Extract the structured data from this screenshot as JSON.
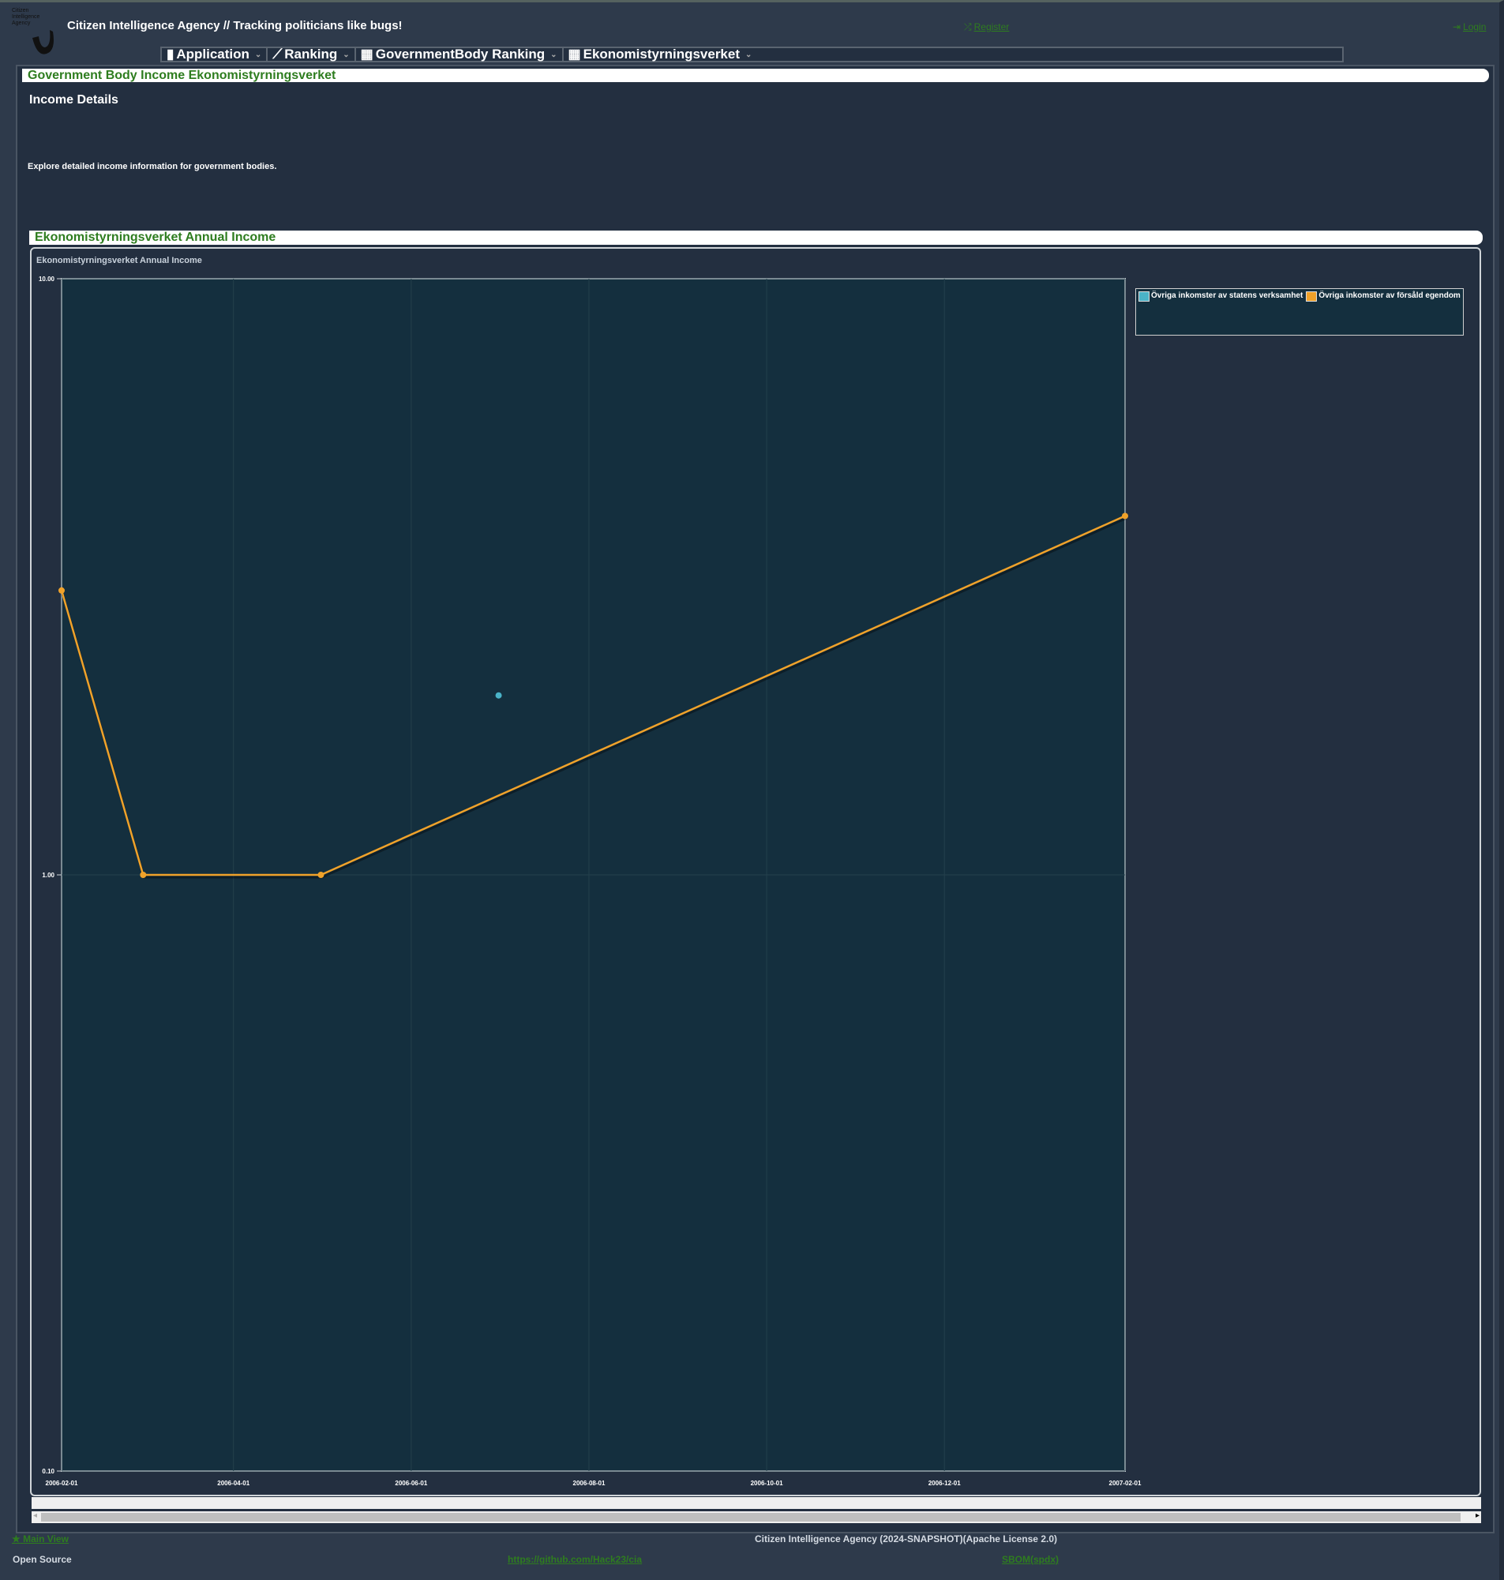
{
  "header": {
    "logo_text": "Citizen Intelligence Agency",
    "title": "Citizen Intelligence Agency  // Tracking politicians like bugs!",
    "register": "Register",
    "login": "Login"
  },
  "nav": [
    {
      "label": "Application",
      "icon": "file-icon"
    },
    {
      "label": "Ranking",
      "icon": "chart-line-icon"
    },
    {
      "label": "GovernmentBody Ranking",
      "icon": "building-icon"
    },
    {
      "label": "Ekonomistyrningsverket",
      "icon": "building-icon"
    }
  ],
  "page": {
    "title": "Government Body Income Ekonomistyrningsverket",
    "section_heading": "Income Details",
    "description": "Explore detailed income information for government bodies.",
    "panel_title": "Ekonomistyrningsverket Annual Income"
  },
  "chart_data": {
    "type": "line",
    "title": "Ekonomistyrningsverket Annual Income",
    "y_scale": "log",
    "ylim": [
      0.1,
      10
    ],
    "y_ticks": [
      "10.00",
      "1.00",
      "0.10"
    ],
    "x_ticks": [
      "2006-02-01",
      "2006-04-01",
      "2006-06-01",
      "2006-08-01",
      "2006-10-01",
      "2006-12-01",
      "2007-02-01"
    ],
    "xlim": [
      "2006-02-01",
      "2007-02-01"
    ],
    "grid": true,
    "legend": "top-right (outside plot)",
    "series": [
      {
        "name": "Övriga inkomster av statens verksamhet",
        "color": "#4ab3c8",
        "points": [
          [
            "2006-07-01",
            2.0
          ]
        ]
      },
      {
        "name": "Övriga inkomster av försåld egendom",
        "color": "#f0a22a",
        "points": [
          [
            "2006-02-01",
            3.0
          ],
          [
            "2006-03-01",
            1.0
          ],
          [
            "2006-05-01",
            1.0
          ],
          [
            "2007-02-01",
            4.0
          ]
        ]
      }
    ]
  },
  "footer": {
    "main_view": "Main View",
    "version": "Citizen Intelligence Agency (2024-SNAPSHOT)(Apache License 2.0)",
    "open_source": "Open Source",
    "github": "https://github.com/Hack23/cia",
    "sbom": "SBOM(spdx)"
  }
}
